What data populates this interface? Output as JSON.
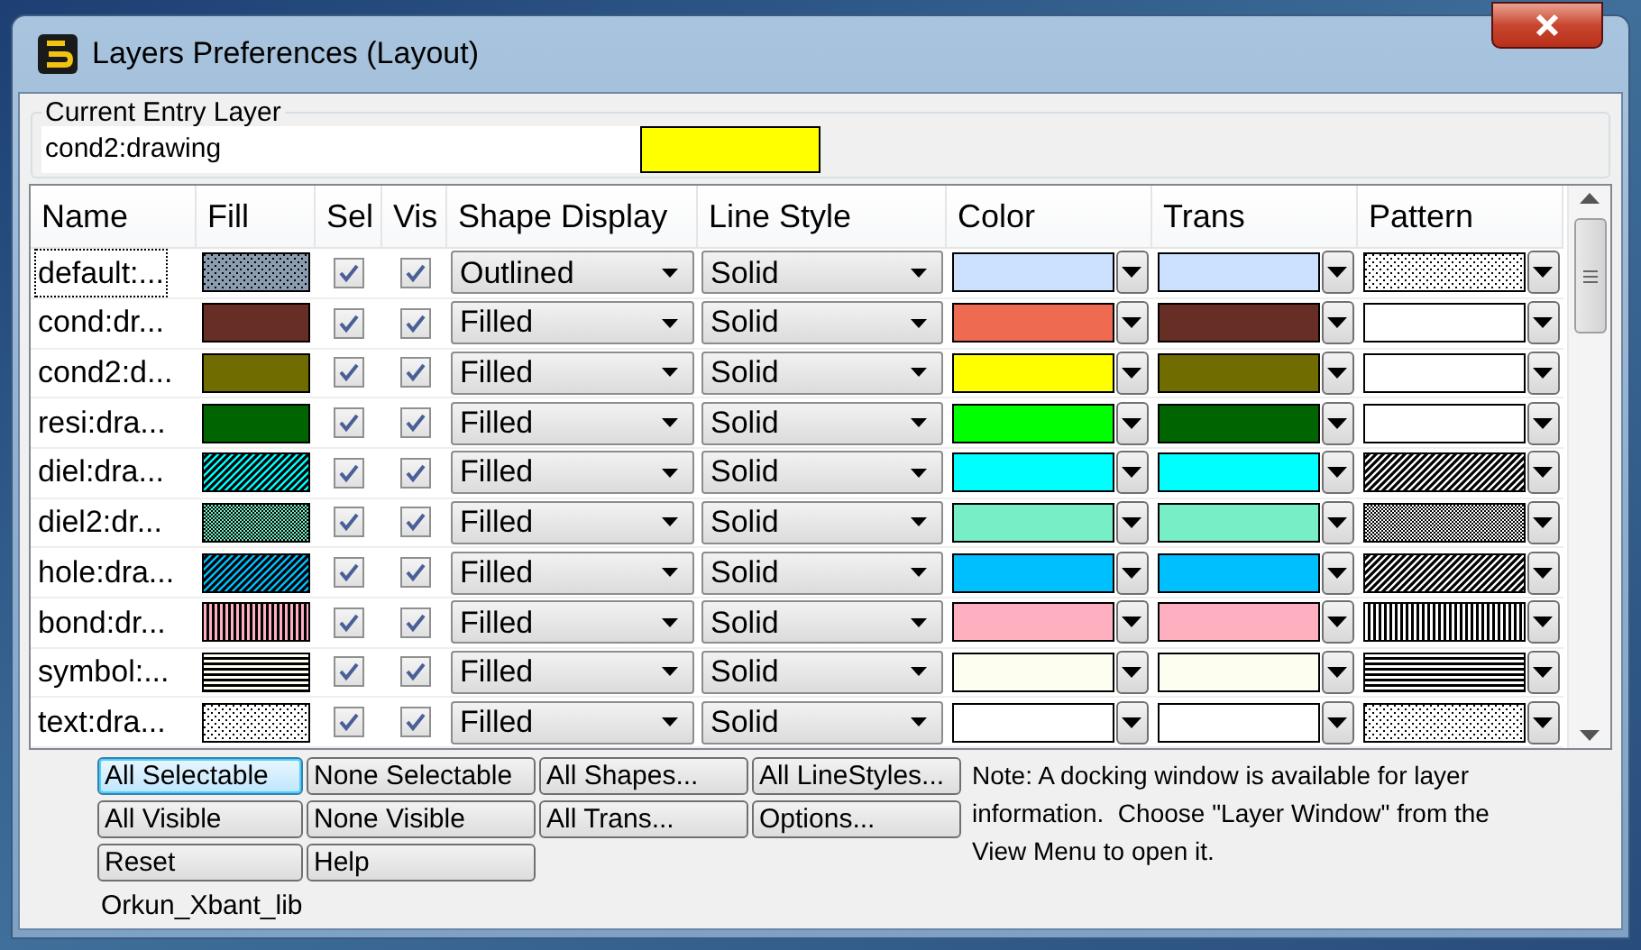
{
  "window": {
    "title": "Layers Preferences (Layout)"
  },
  "current_entry_layer": {
    "label": "Current Entry Layer",
    "value": "cond2:drawing",
    "color": "#ffff00"
  },
  "table": {
    "columns": [
      "Name",
      "Fill",
      "Sel",
      "Vis",
      "Shape Display",
      "Line Style",
      "Color",
      "Trans",
      "Pattern"
    ],
    "rows": [
      {
        "name": "default:...",
        "focused": true,
        "fill": {
          "kind": "grid",
          "color": "#8c9cb0"
        },
        "sel": true,
        "vis": true,
        "shape": "Outlined",
        "line_style": "Solid",
        "color": "#cce0ff",
        "trans": {
          "color": "#cce0ff"
        },
        "pattern": {
          "kind": "grid"
        }
      },
      {
        "name": "cond:dr...",
        "focused": false,
        "fill": {
          "kind": "solid",
          "color": "#662e24"
        },
        "sel": true,
        "vis": true,
        "shape": "Filled",
        "line_style": "Solid",
        "color": "#ee6a50",
        "trans": {
          "color": "#662e24"
        },
        "pattern": {
          "kind": "none"
        }
      },
      {
        "name": "cond2:d...",
        "focused": false,
        "fill": {
          "kind": "solid",
          "color": "#706c00"
        },
        "sel": true,
        "vis": true,
        "shape": "Filled",
        "line_style": "Solid",
        "color": "#ffff00",
        "trans": {
          "color": "#706c00"
        },
        "pattern": {
          "kind": "none"
        }
      },
      {
        "name": "resi:dra...",
        "focused": false,
        "fill": {
          "kind": "solid",
          "color": "#006400"
        },
        "sel": true,
        "vis": true,
        "shape": "Filled",
        "line_style": "Solid",
        "color": "#00ff00",
        "trans": {
          "color": "#006400"
        },
        "pattern": {
          "kind": "none"
        }
      },
      {
        "name": "diel:dra...",
        "focused": false,
        "fill": {
          "kind": "diagonal",
          "color": "#00ffff"
        },
        "sel": true,
        "vis": true,
        "shape": "Filled",
        "line_style": "Solid",
        "color": "#00ffff",
        "trans": {
          "color": "#00ffff"
        },
        "pattern": {
          "kind": "diagonal"
        }
      },
      {
        "name": "diel2:dr...",
        "focused": false,
        "fill": {
          "kind": "checker",
          "color": "#77eec6"
        },
        "sel": true,
        "vis": true,
        "shape": "Filled",
        "line_style": "Solid",
        "color": "#77eec6",
        "trans": {
          "color": "#77eec6"
        },
        "pattern": {
          "kind": "checker"
        }
      },
      {
        "name": "hole:dra...",
        "focused": false,
        "fill": {
          "kind": "diagonal",
          "color": "#00bfff"
        },
        "sel": true,
        "vis": true,
        "shape": "Filled",
        "line_style": "Solid",
        "color": "#00bfff",
        "trans": {
          "color": "#00bfff"
        },
        "pattern": {
          "kind": "diagonal"
        }
      },
      {
        "name": "bond:dr...",
        "focused": false,
        "fill": {
          "kind": "vertical",
          "color": "#ffb0c0"
        },
        "sel": true,
        "vis": true,
        "shape": "Filled",
        "line_style": "Solid",
        "color": "#ffb0c0",
        "trans": {
          "color": "#ffb0c0"
        },
        "pattern": {
          "kind": "vertical"
        }
      },
      {
        "name": "symbol:...",
        "focused": false,
        "fill": {
          "kind": "horizontal",
          "color": "#fffff0"
        },
        "sel": true,
        "vis": true,
        "shape": "Filled",
        "line_style": "Solid",
        "color": "#fdfdf0",
        "trans": {
          "color": "#fdfdf0"
        },
        "pattern": {
          "kind": "horizontal"
        }
      },
      {
        "name": "text:dra...",
        "focused": false,
        "fill": {
          "kind": "grid",
          "color": "#ffffff"
        },
        "sel": true,
        "vis": true,
        "shape": "Filled",
        "line_style": "Solid",
        "color": "#ffffff",
        "trans": {
          "color": "#ffffff"
        },
        "pattern": {
          "kind": "grid"
        }
      }
    ]
  },
  "buttons": [
    {
      "label": "All Selectable",
      "focused": true
    },
    {
      "label": "None Selectable",
      "focused": false
    },
    {
      "label": "All Shapes...",
      "focused": false
    },
    {
      "label": "All LineStyles...",
      "focused": false
    },
    {
      "label": "All Visible",
      "focused": false
    },
    {
      "label": "None Visible",
      "focused": false
    },
    {
      "label": "All Trans...",
      "focused": false
    },
    {
      "label": "Options...",
      "focused": false
    },
    {
      "label": "Reset",
      "focused": false
    },
    {
      "label": "Help",
      "focused": false
    }
  ],
  "note": "Note: A docking window is available for layer information.  Choose \"Layer Window\" from the View Menu to open it.",
  "library": "Orkun_Xbant_lib"
}
